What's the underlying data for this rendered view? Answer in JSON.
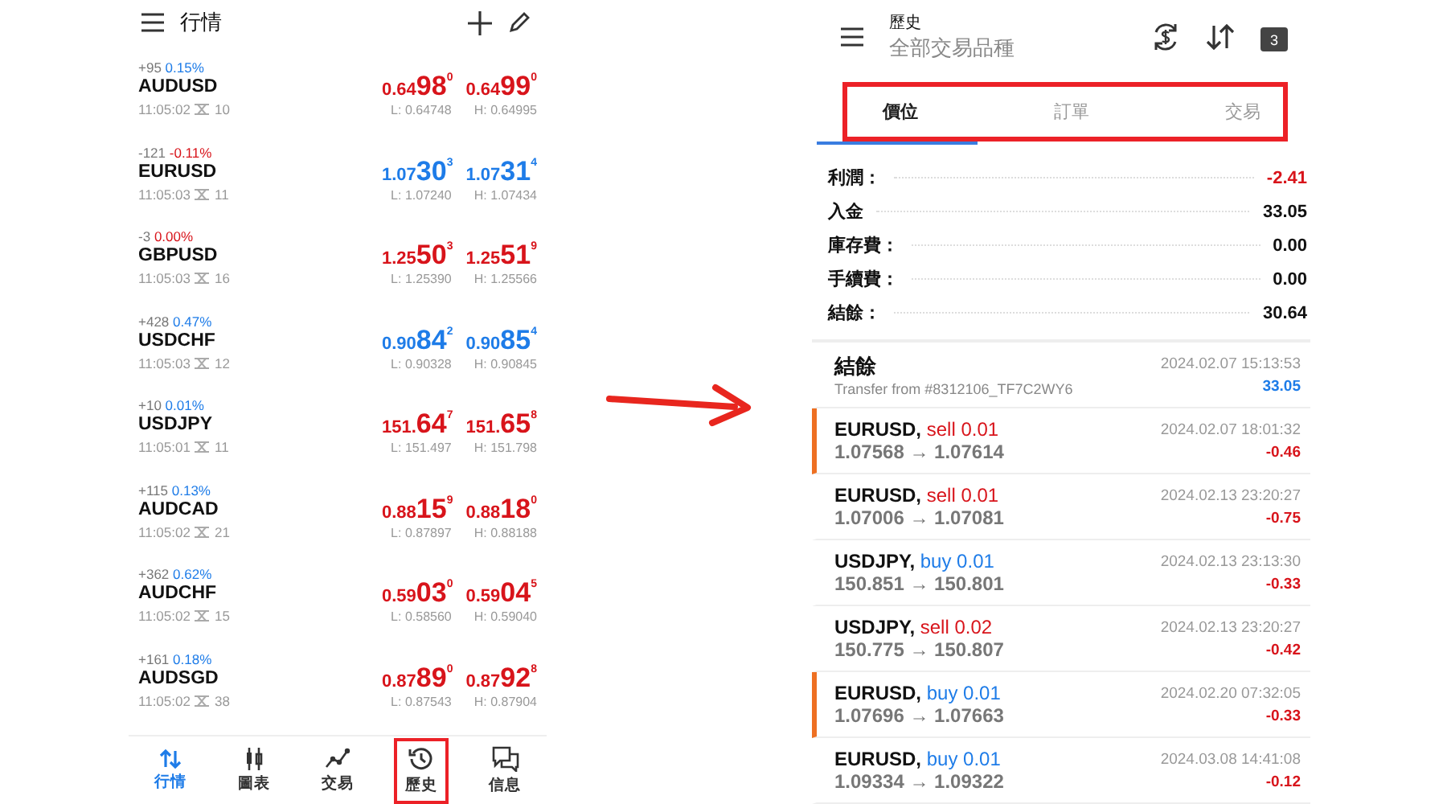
{
  "quotes_screen": {
    "title": "行情",
    "quotes": [
      {
        "change": "+95",
        "percent": "0.15%",
        "change_negative": false,
        "symbol": "AUDUSD",
        "time": "11:05:02",
        "spread": "10",
        "price_rising": false,
        "bid": {
          "head": "0.64",
          "big": "98",
          "pip": "0"
        },
        "ask": {
          "head": "0.64",
          "big": "99",
          "pip": "0"
        },
        "low": "L: 0.64748",
        "high": "H: 0.64995"
      },
      {
        "change": "-121",
        "percent": "-0.11%",
        "change_negative": true,
        "symbol": "EURUSD",
        "time": "11:05:03",
        "spread": "11",
        "price_rising": true,
        "bid": {
          "head": "1.07",
          "big": "30",
          "pip": "3"
        },
        "ask": {
          "head": "1.07",
          "big": "31",
          "pip": "4"
        },
        "low": "L: 1.07240",
        "high": "H: 1.07434"
      },
      {
        "change": "-3",
        "percent": "0.00%",
        "change_negative": true,
        "symbol": "GBPUSD",
        "time": "11:05:03",
        "spread": "16",
        "price_rising": false,
        "bid": {
          "head": "1.25",
          "big": "50",
          "pip": "3"
        },
        "ask": {
          "head": "1.25",
          "big": "51",
          "pip": "9"
        },
        "low": "L: 1.25390",
        "high": "H: 1.25566"
      },
      {
        "change": "+428",
        "percent": "0.47%",
        "change_negative": false,
        "symbol": "USDCHF",
        "time": "11:05:03",
        "spread": "12",
        "price_rising": true,
        "bid": {
          "head": "0.90",
          "big": "84",
          "pip": "2"
        },
        "ask": {
          "head": "0.90",
          "big": "85",
          "pip": "4"
        },
        "low": "L: 0.90328",
        "high": "H: 0.90845"
      },
      {
        "change": "+10",
        "percent": "0.01%",
        "change_negative": false,
        "symbol": "USDJPY",
        "time": "11:05:01",
        "spread": "11",
        "price_rising": false,
        "bid": {
          "head": "151.",
          "big": "64",
          "pip": "7"
        },
        "ask": {
          "head": "151.",
          "big": "65",
          "pip": "8"
        },
        "low": "L: 151.497",
        "high": "H: 151.798"
      },
      {
        "change": "+115",
        "percent": "0.13%",
        "change_negative": false,
        "symbol": "AUDCAD",
        "time": "11:05:02",
        "spread": "21",
        "price_rising": false,
        "bid": {
          "head": "0.88",
          "big": "15",
          "pip": "9"
        },
        "ask": {
          "head": "0.88",
          "big": "18",
          "pip": "0"
        },
        "low": "L: 0.87897",
        "high": "H: 0.88188"
      },
      {
        "change": "+362",
        "percent": "0.62%",
        "change_negative": false,
        "symbol": "AUDCHF",
        "time": "11:05:02",
        "spread": "15",
        "price_rising": false,
        "bid": {
          "head": "0.59",
          "big": "03",
          "pip": "0"
        },
        "ask": {
          "head": "0.59",
          "big": "04",
          "pip": "5"
        },
        "low": "L: 0.58560",
        "high": "H: 0.59040"
      },
      {
        "change": "+161",
        "percent": "0.18%",
        "change_negative": false,
        "symbol": "AUDSGD",
        "time": "11:05:02",
        "spread": "38",
        "price_rising": false,
        "bid": {
          "head": "0.87",
          "big": "89",
          "pip": "0"
        },
        "ask": {
          "head": "0.87",
          "big": "92",
          "pip": "8"
        },
        "low": "L: 0.87543",
        "high": "H: 0.87904"
      }
    ],
    "nav": [
      {
        "kind": "quotes",
        "label": "行情",
        "selected": true,
        "highlighted": false
      },
      {
        "kind": "chart",
        "label": "圖表",
        "selected": false,
        "highlighted": false
      },
      {
        "kind": "trade",
        "label": "交易",
        "selected": false,
        "highlighted": false
      },
      {
        "kind": "history",
        "label": "歷史",
        "selected": false,
        "highlighted": true
      },
      {
        "kind": "messages",
        "label": "信息",
        "selected": false,
        "highlighted": false
      }
    ]
  },
  "history_screen": {
    "title": "歷史",
    "subtitle": "全部交易品種",
    "calendar_day": "3",
    "tabs_highlighted": true,
    "tabs": [
      {
        "label": "價位",
        "selected": true
      },
      {
        "label": "訂單",
        "selected": false
      },
      {
        "label": "交易",
        "selected": false
      }
    ],
    "summary": [
      {
        "label": "利潤：",
        "value": "-2.41",
        "negative": true
      },
      {
        "label": "入金",
        "value": "33.05",
        "negative": false
      },
      {
        "label": "庫存費：",
        "value": "0.00",
        "negative": false
      },
      {
        "label": "手續費：",
        "value": "0.00",
        "negative": false
      },
      {
        "label": "結餘：",
        "value": "30.64",
        "negative": false
      }
    ],
    "deals": [
      {
        "kind": "balance",
        "title": "結餘",
        "comment": "Transfer from #8312106_TF7C2WY6",
        "time": "2024.02.07 15:13:53",
        "amount": "33.05"
      },
      {
        "kind": "trade",
        "symbol": "EURUSD,",
        "order": "sell 0.01",
        "buy": false,
        "prices": "1.07568 → 1.07614",
        "time": "2024.02.07 18:01:32",
        "amount": "-0.46",
        "marked": true
      },
      {
        "kind": "trade",
        "symbol": "EURUSD,",
        "order": "sell 0.01",
        "buy": false,
        "prices": "1.07006 → 1.07081",
        "time": "2024.02.13 23:20:27",
        "amount": "-0.75",
        "marked": false
      },
      {
        "kind": "trade",
        "symbol": "USDJPY,",
        "order": "buy 0.01",
        "buy": true,
        "prices": "150.851 → 150.801",
        "time": "2024.02.13 23:13:30",
        "amount": "-0.33",
        "marked": false
      },
      {
        "kind": "trade",
        "symbol": "USDJPY,",
        "order": "sell 0.02",
        "buy": false,
        "prices": "150.775 → 150.807",
        "time": "2024.02.13 23:20:27",
        "amount": "-0.42",
        "marked": false
      },
      {
        "kind": "trade",
        "symbol": "EURUSD,",
        "order": "buy 0.01",
        "buy": true,
        "prices": "1.07696 → 1.07663",
        "time": "2024.02.20 07:32:05",
        "amount": "-0.33",
        "marked": true
      },
      {
        "kind": "trade",
        "symbol": "EURUSD,",
        "order": "buy 0.01",
        "buy": true,
        "prices": "1.09334 → 1.09322",
        "time": "2024.03.08 14:41:08",
        "amount": "-0.12",
        "marked": false
      }
    ]
  }
}
